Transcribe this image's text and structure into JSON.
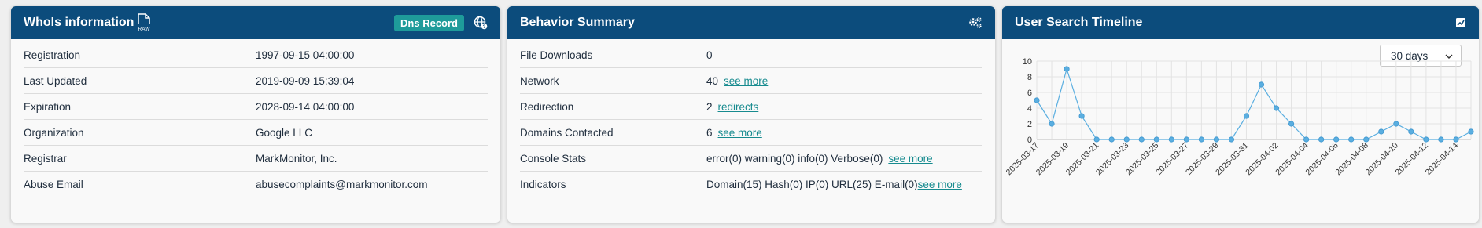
{
  "whois": {
    "title": "WhoIs information",
    "raw_label": "RAW",
    "dns_button": "Dns Record",
    "rows": [
      {
        "label": "Registration",
        "value": "1997-09-15 04:00:00"
      },
      {
        "label": "Last Updated",
        "value": "2019-09-09 15:39:04"
      },
      {
        "label": "Expiration",
        "value": "2028-09-14 04:00:00"
      },
      {
        "label": "Organization",
        "value": "Google LLC"
      },
      {
        "label": "Registrar",
        "value": "MarkMonitor, Inc."
      },
      {
        "label": "Abuse Email",
        "value": "abusecomplaints@markmonitor.com"
      }
    ]
  },
  "behavior": {
    "title": "Behavior Summary",
    "rows": [
      {
        "label": "File Downloads",
        "value": "0",
        "link": ""
      },
      {
        "label": "Network",
        "value": "40",
        "link": "see more"
      },
      {
        "label": "Redirection",
        "value": "2",
        "link": "redirects"
      },
      {
        "label": "Domains Contacted",
        "value": "6",
        "link": "see more"
      },
      {
        "label": "Console Stats",
        "value": "error(0) warning(0) info(0) Verbose(0)",
        "link": "see more"
      },
      {
        "label": "Indicators",
        "value": "Domain(15) Hash(0) IP(0) URL(25) E-mail(0)",
        "link": "see more"
      }
    ]
  },
  "timeline": {
    "title": "User Search Timeline",
    "range_select": "30 days",
    "colors": {
      "line": "#5aaee0",
      "point": "#5aaee0",
      "grid": "#e3e3e3",
      "header": "#0c4c7c",
      "accent": "#1e9b9a"
    }
  },
  "chart_data": {
    "type": "line",
    "title": "",
    "xlabel": "",
    "ylabel": "",
    "x": [
      "2025-03-17",
      "2025-03-18",
      "2025-03-19",
      "2025-03-20",
      "2025-03-21",
      "2025-03-22",
      "2025-03-23",
      "2025-03-24",
      "2025-03-25",
      "2025-03-26",
      "2025-03-27",
      "2025-03-28",
      "2025-03-29",
      "2025-03-30",
      "2025-03-31",
      "2025-04-01",
      "2025-04-02",
      "2025-04-03",
      "2025-04-04",
      "2025-04-05",
      "2025-04-06",
      "2025-04-07",
      "2025-04-08",
      "2025-04-09",
      "2025-04-10",
      "2025-04-11",
      "2025-04-12",
      "2025-04-13",
      "2025-04-14",
      "2025-04-15"
    ],
    "values": [
      5,
      2,
      9,
      3,
      0,
      0,
      0,
      0,
      0,
      0,
      0,
      0,
      0,
      0,
      3,
      7,
      4,
      2,
      0,
      0,
      0,
      0,
      0,
      1,
      2,
      1,
      0,
      0,
      0,
      1
    ],
    "tick_labels": [
      "2025-03-17",
      "2025-03-19",
      "2025-03-21",
      "2025-03-23",
      "2025-03-25",
      "2025-03-27",
      "2025-03-29",
      "2025-03-31",
      "2025-04-02",
      "2025-04-04",
      "2025-04-06",
      "2025-04-08",
      "2025-04-10",
      "2025-04-12",
      "2025-04-14"
    ],
    "y_ticks": [
      "0",
      "2",
      "4",
      "6",
      "8",
      "10"
    ],
    "ylim": [
      0,
      10
    ],
    "grid": true,
    "legend": false
  }
}
